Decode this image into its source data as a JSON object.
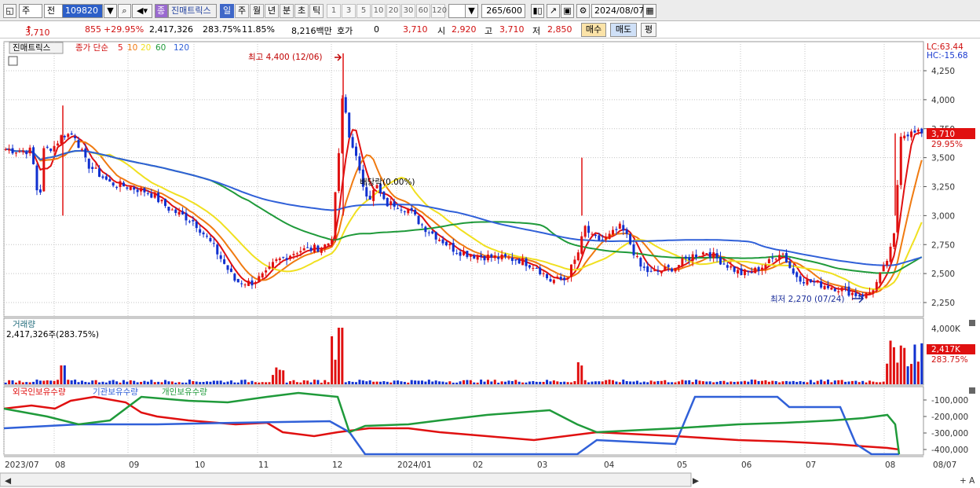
{
  "toolbar": {
    "market": "주",
    "mode": "전",
    "code": "109820",
    "name": "진매트릭스",
    "name_badge": "종",
    "periods": [
      "일",
      "주",
      "월",
      "년",
      "분",
      "초",
      "틱"
    ],
    "active_period": "일",
    "numbers": [
      "1",
      "3",
      "5",
      "10",
      "20",
      "30",
      "60",
      "120"
    ],
    "count": "265",
    "count_max": "/600",
    "date": "2024/08/07"
  },
  "info": {
    "price": "3,710",
    "change": "855",
    "pct": "+29.95%",
    "volume": "2,417,326",
    "vol_ratio": "283.75%",
    "turnover": "11.85%",
    "amount": "8,216백만",
    "quote_label": "호가",
    "quote": "0",
    "ask": "3,710",
    "open_label": "시",
    "open": "2,920",
    "high_label": "고",
    "high": "3,710",
    "low_label": "저",
    "low": "2,850",
    "buy": "매수",
    "sell": "매도",
    "avg": "평"
  },
  "price_panel": {
    "name": "진매트릭스",
    "ma_label": "종가 단순",
    "ma_periods": [
      "5",
      "10",
      "20",
      "60",
      "120"
    ],
    "ma_colors": [
      "#e01010",
      "#f07a10",
      "#f0e020",
      "#1f9a3a",
      "#3060d8"
    ],
    "high_note": "최고 4,400 (12/06)",
    "low_note": "최저 2,270 (07/24)",
    "div_note": "배당락(0.00%)",
    "lc": "LC:63.44",
    "hc": "HC:-15.68",
    "last": "3,710",
    "last_pct": "29.95%",
    "axis": [
      "4,250",
      "4,000",
      "3,750",
      "3,500",
      "3,250",
      "3,000",
      "2,750",
      "2,500",
      "2,250"
    ]
  },
  "volume_panel": {
    "title": "거래량",
    "value": "2,417,326주(283.75%)",
    "axis": "4,000K",
    "last": "2,417K",
    "last_pct": "283.75%"
  },
  "holdings_panel": {
    "labels": [
      "외국인보유수량",
      "기관보유수량",
      "개인보유수량"
    ],
    "colors": [
      "#e01010",
      "#3060d8",
      "#1f9a3a"
    ],
    "axis": [
      "-100,000",
      "-200,000",
      "-300,000",
      "-400,000"
    ]
  },
  "x_axis": [
    "2023/07",
    "08",
    "09",
    "10",
    "11",
    "12",
    "2024/01",
    "02",
    "03",
    "04",
    "05",
    "06",
    "07",
    "08"
  ],
  "x_right": "08/07",
  "colors": {
    "up": "#e01010",
    "down": "#1030d0",
    "grid": "#c4c4c4"
  }
}
